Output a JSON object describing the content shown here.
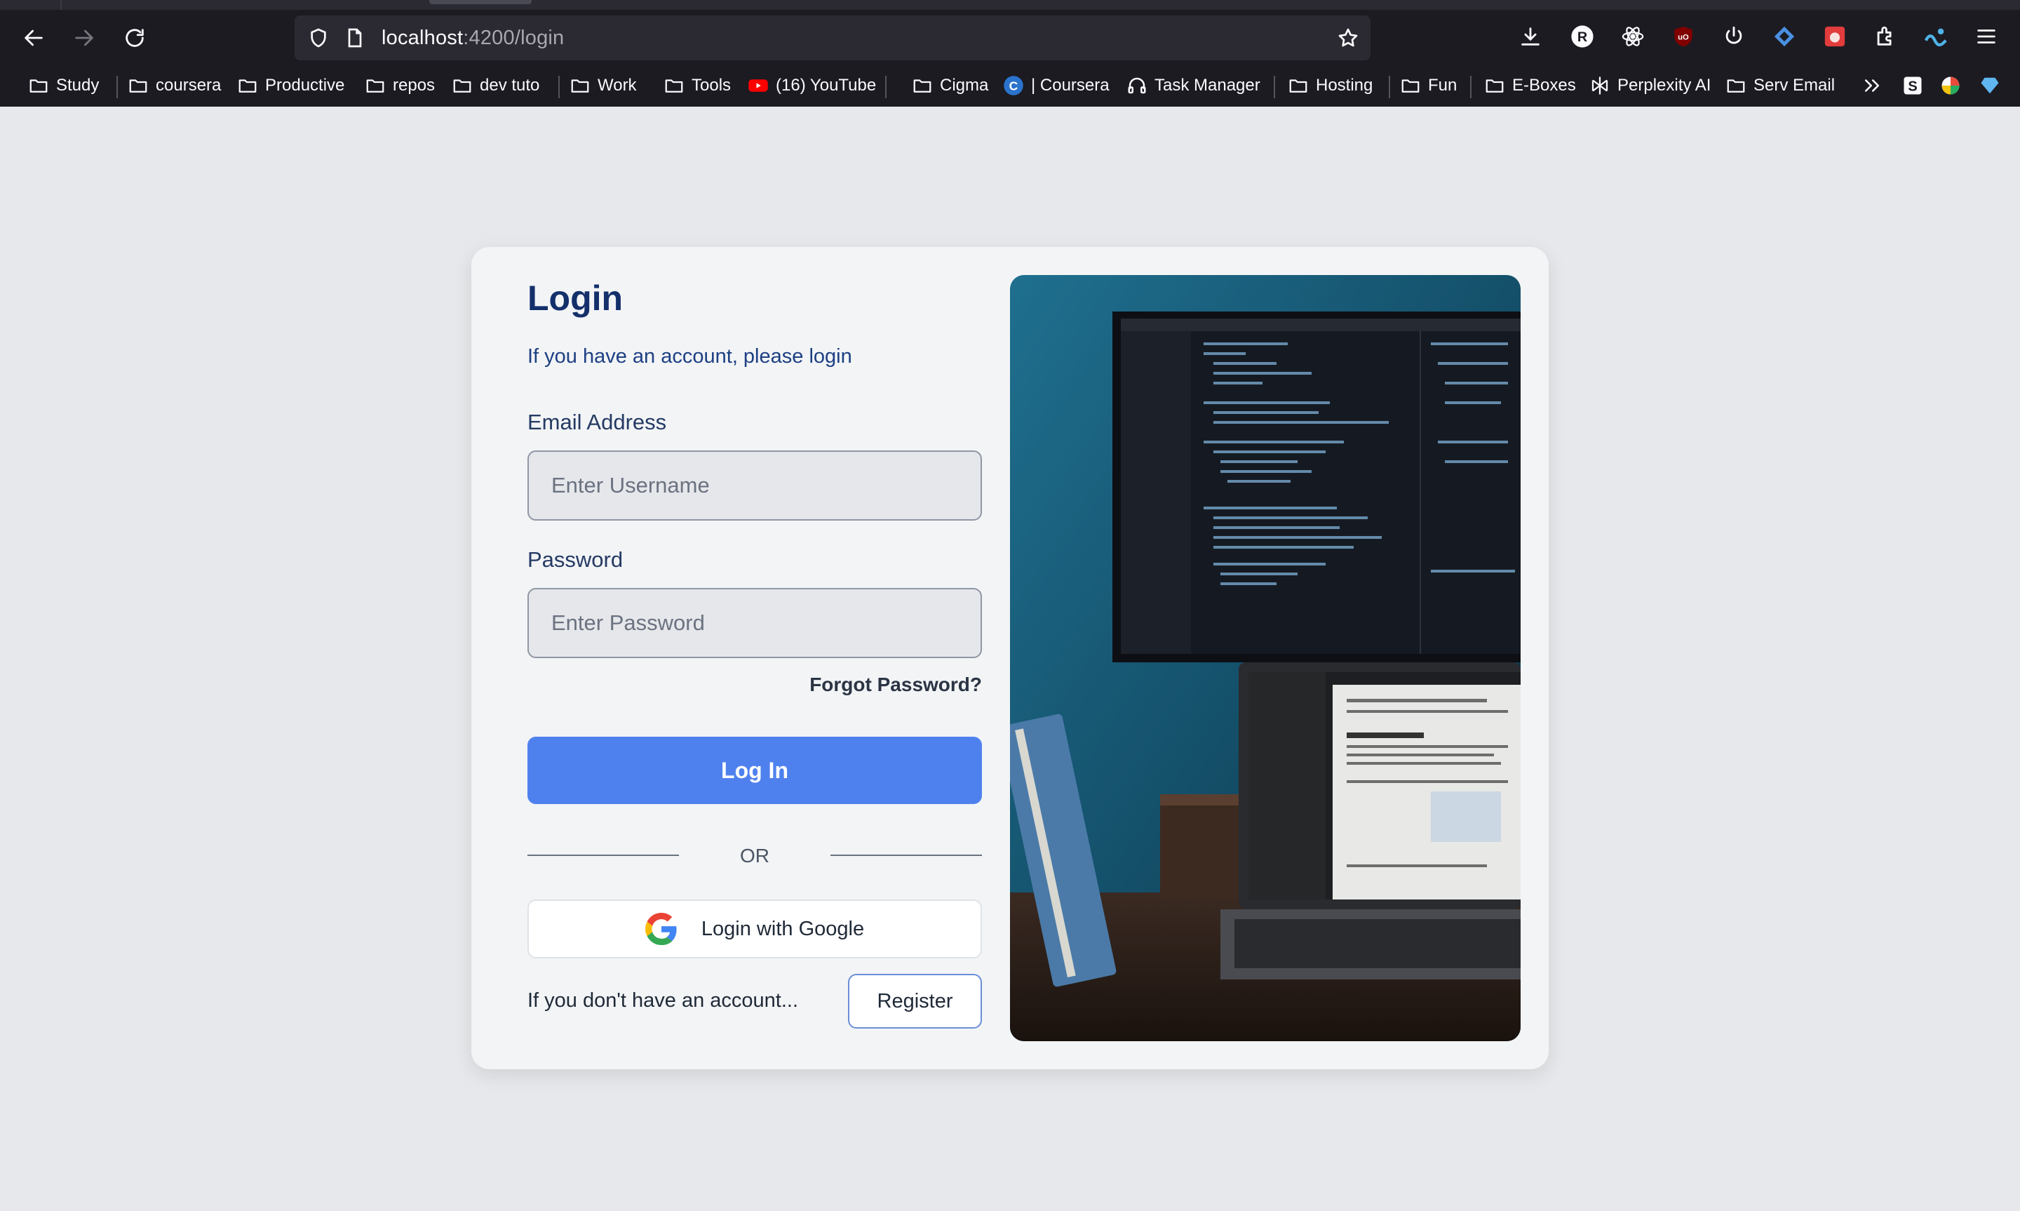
{
  "browser": {
    "url_host": "localhost",
    "url_path": ":4200/login",
    "bookmarks": [
      {
        "label": "Study",
        "icon": "folder-icon"
      },
      {
        "label": "coursera",
        "icon": "folder-icon"
      },
      {
        "label": "Productive",
        "icon": "folder-icon"
      },
      {
        "label": "repos",
        "icon": "folder-icon"
      },
      {
        "label": "dev tuto",
        "icon": "folder-icon"
      },
      {
        "label": "Work",
        "icon": "folder-icon"
      },
      {
        "label": "Tools",
        "icon": "folder-icon"
      },
      {
        "label": "(16) YouTube",
        "icon": "youtube-icon"
      },
      {
        "label": "Cigma",
        "icon": "folder-icon"
      },
      {
        "label": "| Coursera",
        "icon": "coursera-icon"
      },
      {
        "label": "Task Manager",
        "icon": "headset-icon"
      },
      {
        "label": "Hosting",
        "icon": "folder-icon"
      },
      {
        "label": "Fun",
        "icon": "folder-icon"
      },
      {
        "label": "E-Boxes",
        "icon": "folder-icon"
      },
      {
        "label": "Perplexity AI",
        "icon": "perplexity-icon"
      },
      {
        "label": "Serv Email",
        "icon": "folder-icon"
      }
    ],
    "colors": {
      "chrome": "#1c1b22",
      "urlbar": "#2b2a33"
    }
  },
  "login": {
    "title": "Login",
    "subtitle": "If you have an account, please login",
    "email_label": "Email Address",
    "email_placeholder": "Enter Username",
    "password_label": "Password",
    "password_placeholder": "Enter Password",
    "forgot": "Forgot Password?",
    "login_button": "Log In",
    "or": "OR",
    "google_button": "Login with Google",
    "no_account": "If you don't have an account...",
    "register_button": "Register"
  },
  "colors": {
    "page_bg": "#e6e8eb",
    "card_bg": "#f2f4f6",
    "title": "#14306b",
    "primary": "#4f81ee"
  }
}
